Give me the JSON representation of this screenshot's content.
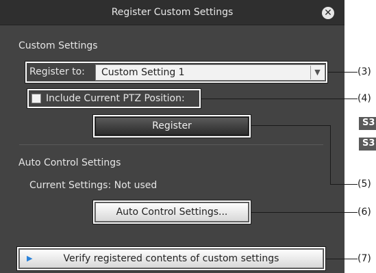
{
  "dialog": {
    "title": "Register Custom Settings",
    "close_icon": "close-icon",
    "custom_settings": {
      "heading": "Custom Settings",
      "register_to_label": "Register to:",
      "register_to_value": "Custom Setting 1",
      "include_ptz_label": "Include Current PTZ Position:",
      "include_ptz_checked": false,
      "register_button": "Register"
    },
    "auto_control": {
      "heading": "Auto Control Settings",
      "current_settings": "Current Settings: Not used",
      "button": "Auto Control Settings..."
    },
    "verify_button": "Verify registered contents of custom settings"
  },
  "callouts": {
    "c3": "(3)",
    "c4": "(4)",
    "c5": "(5)",
    "c6": "(6)",
    "c7": "(7)"
  },
  "side_badges": [
    "S3",
    "S3"
  ],
  "colors": {
    "dialog_bg": "#434343",
    "titlebar_bg": "#2f2f2f",
    "accent_arrow": "#2a82d9"
  }
}
